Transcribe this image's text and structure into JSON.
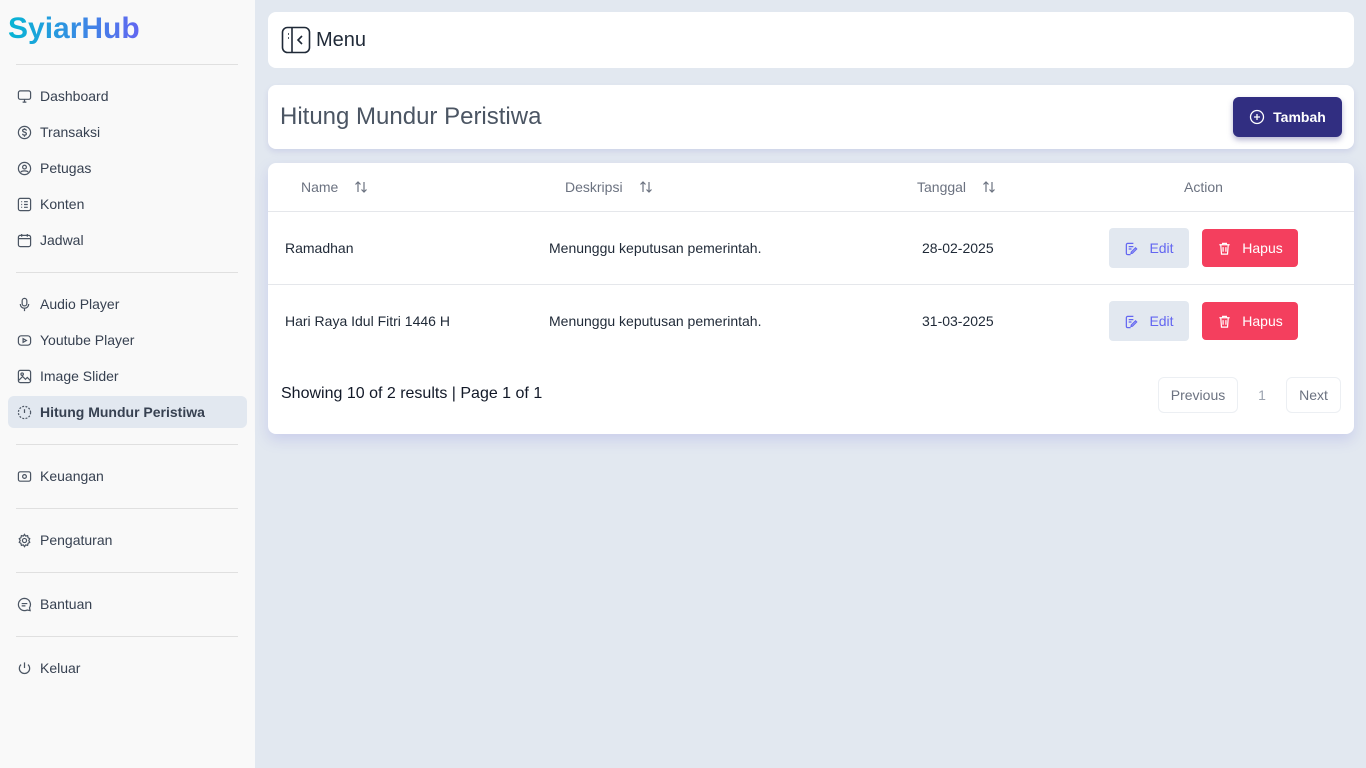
{
  "brand": "SyiarHub",
  "sidebar": {
    "groups": [
      [
        {
          "label": "Dashboard",
          "icon": "monitor-icon"
        },
        {
          "label": "Transaksi",
          "icon": "dollar-circle-icon"
        },
        {
          "label": "Petugas",
          "icon": "user-circle-icon"
        },
        {
          "label": "Konten",
          "icon": "list-icon"
        },
        {
          "label": "Jadwal",
          "icon": "calendar-icon"
        }
      ],
      [
        {
          "label": "Audio Player",
          "icon": "microphone-icon"
        },
        {
          "label": "Youtube Player",
          "icon": "youtube-icon"
        },
        {
          "label": "Image Slider",
          "icon": "image-icon"
        },
        {
          "label": "Hitung Mundur Peristiwa",
          "icon": "countdown-icon",
          "active": true
        }
      ],
      [
        {
          "label": "Keuangan",
          "icon": "wallet-icon"
        }
      ],
      [
        {
          "label": "Pengaturan",
          "icon": "gear-icon"
        }
      ],
      [
        {
          "label": "Bantuan",
          "icon": "chat-icon"
        }
      ],
      [
        {
          "label": "Keluar",
          "icon": "power-icon"
        }
      ]
    ]
  },
  "menubar": {
    "label": "Menu",
    "icon": "sidebar-toggle-icon"
  },
  "page": {
    "title": "Hitung Mundur Peristiwa",
    "add_label": "Tambah"
  },
  "table": {
    "columns": [
      {
        "label": "Name",
        "sortable": true
      },
      {
        "label": "Deskripsi",
        "sortable": true
      },
      {
        "label": "Tanggal",
        "sortable": true
      },
      {
        "label": "Action",
        "sortable": false
      }
    ],
    "rows": [
      {
        "name": "Ramadhan",
        "deskripsi": "Menunggu keputusan pemerintah.",
        "tanggal": "28-02-2025"
      },
      {
        "name": "Hari Raya Idul Fitri 1446 H",
        "deskripsi": "Menunggu keputusan pemerintah.",
        "tanggal": "31-03-2025"
      }
    ],
    "edit_label": "Edit",
    "delete_label": "Hapus"
  },
  "pagination": {
    "summary": "Showing 10 of 2 results | Page 1 of 1",
    "previous": "Previous",
    "current": "1",
    "next": "Next"
  },
  "colors": {
    "primary": "#312e81",
    "danger": "#f43f5e",
    "edit_text": "#6366f1",
    "background": "#e2e8f0"
  }
}
